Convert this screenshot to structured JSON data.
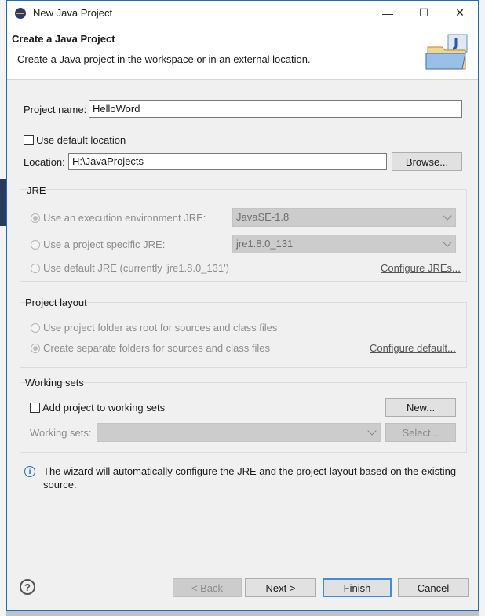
{
  "window": {
    "title": "New Java Project"
  },
  "banner": {
    "heading": "Create a Java Project",
    "subtitle": "Create a Java project in the workspace or in an external location."
  },
  "project": {
    "name_label": "Project name:",
    "name_value": "HelloWord"
  },
  "location": {
    "use_default_label": "Use default location",
    "location_label": "Location:",
    "location_value": "H:\\JavaProjects",
    "browse_label": "Browse..."
  },
  "jre": {
    "title": "JRE",
    "exec_env_label": "Use an execution environment JRE:",
    "exec_env_value": "JavaSE-1.8",
    "project_specific_label": "Use a project specific JRE:",
    "project_specific_value": "jre1.8.0_131",
    "default_label": "Use default JRE (currently 'jre1.8.0_131')",
    "configure_link": "Configure JREs..."
  },
  "layout": {
    "title": "Project layout",
    "root_label": "Use project folder as root for sources and class files",
    "separate_label": "Create separate folders for sources and class files",
    "configure_link": "Configure default..."
  },
  "working_sets": {
    "title": "Working sets",
    "add_label": "Add project to working sets",
    "new_label": "New...",
    "sets_label": "Working sets:",
    "select_label": "Select..."
  },
  "info": {
    "text": "The wizard will automatically configure the JRE and the project layout based on the existing source."
  },
  "footer": {
    "back": "< Back",
    "next": "Next >",
    "finish": "Finish",
    "cancel": "Cancel",
    "help_glyph": "?"
  },
  "icons": {
    "window": "java-app-icon",
    "wizard": "java-project-folder-icon",
    "info": "info-icon",
    "help": "help-icon"
  },
  "colors": {
    "accent": "#3c8ddc",
    "border": "#1c6fb7"
  }
}
